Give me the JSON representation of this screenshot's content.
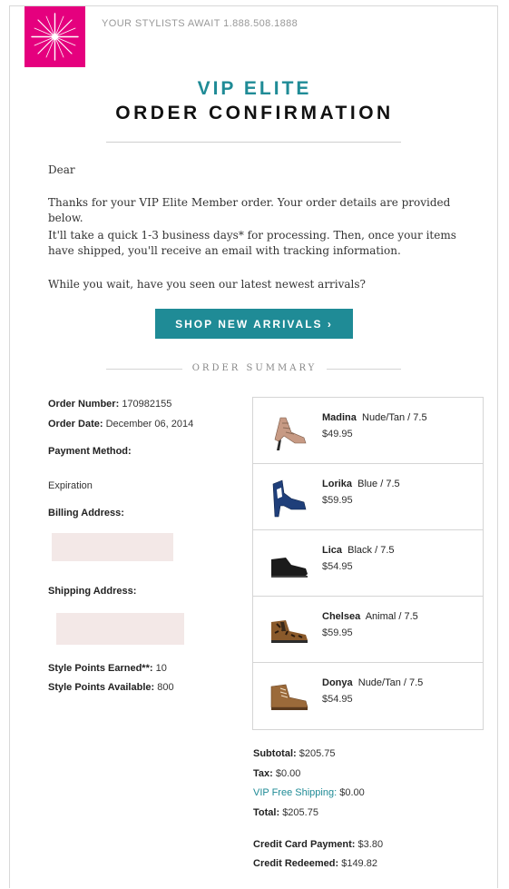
{
  "header": {
    "stylists_line": "YOUR STYLISTS AWAIT 1.888.508.1888",
    "title_vip": "VIP ELITE",
    "title_main": "ORDER CONFIRMATION"
  },
  "message": {
    "greeting": "Dear",
    "p1": "Thanks for your VIP Elite Member order. Your order details are provided below.",
    "p2": "It'll take a quick 1-3 business days* for processing. Then, once your items have shipped, you'll receive an email with tracking information.",
    "p3": "While you wait, have you seen our latest newest arrivals?"
  },
  "cta": {
    "label": "SHOP NEW ARRIVALS ›"
  },
  "summary_label": "ORDER SUMMARY",
  "order": {
    "number_label": "Order Number:",
    "number": "170982155",
    "date_label": "Order Date:",
    "date": "December 06, 2014",
    "payment_label": "Payment Method:",
    "expiration_label": "Expiration",
    "billing_label": "Billing Address:",
    "shipping_label": "Shipping Address:",
    "points_earned_label": "Style Points Earned**:",
    "points_earned": "10",
    "points_available_label": "Style Points Available:",
    "points_available": "800"
  },
  "products": [
    {
      "name": "Madina",
      "variant": "Nude/Tan / 7.5",
      "price": "$49.95",
      "icon": "heeled-sandal-icon",
      "color": "#c79a84"
    },
    {
      "name": "Lorika",
      "variant": "Blue / 7.5",
      "price": "$59.95",
      "icon": "cutout-bootie-icon",
      "color": "#1f3f7a"
    },
    {
      "name": "Lica",
      "variant": "Black / 7.5",
      "price": "$54.95",
      "icon": "ankle-boot-icon",
      "color": "#1b1b1b"
    },
    {
      "name": "Chelsea",
      "variant": "Animal / 7.5",
      "price": "$59.95",
      "icon": "chelsea-boot-icon",
      "color": "#8a5a2b"
    },
    {
      "name": "Donya",
      "variant": "Nude/Tan / 7.5",
      "price": "$54.95",
      "icon": "lace-up-boot-icon",
      "color": "#9b6a3a"
    }
  ],
  "totals": {
    "subtotal_label": "Subtotal:",
    "subtotal": "$205.75",
    "tax_label": "Tax:",
    "tax": "$0.00",
    "shipping_label": "VIP Free Shipping:",
    "shipping": "$0.00",
    "total_label": "Total:",
    "total": "$205.75",
    "cc_label": "Credit Card Payment:",
    "cc": "$3.80",
    "credit_label": "Credit Redeemed:",
    "credit": "$149.82"
  },
  "colors": {
    "brand_pink": "#e5007e",
    "accent_teal": "#1f8b96"
  }
}
